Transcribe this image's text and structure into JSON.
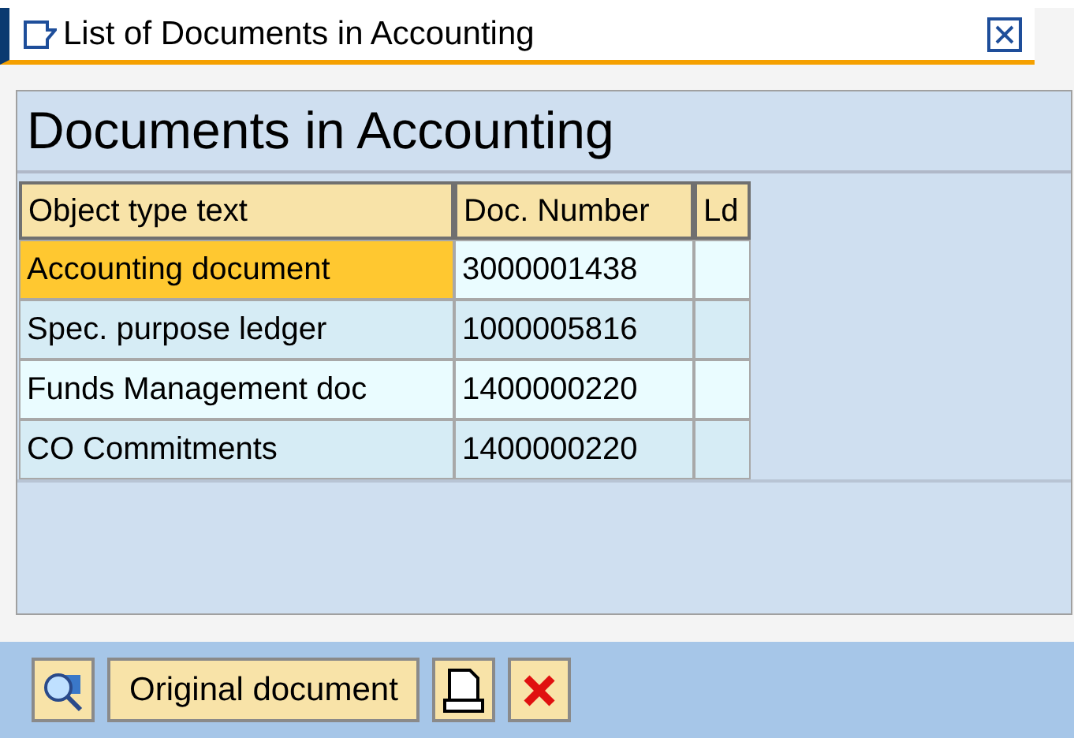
{
  "window": {
    "title": "List of Documents in Accounting"
  },
  "heading": "Documents in Accounting",
  "table": {
    "columns": [
      "Object type text",
      "Doc. Number",
      "Ld"
    ],
    "rows": [
      {
        "cells": [
          "Accounting document",
          "3000001438",
          ""
        ],
        "selected": true
      },
      {
        "cells": [
          "Spec. purpose ledger",
          "1000005816",
          ""
        ],
        "selected": false
      },
      {
        "cells": [
          "Funds Management doc",
          "1400000220",
          ""
        ],
        "selected": false
      },
      {
        "cells": [
          "CO Commitments",
          "1400000220",
          ""
        ],
        "selected": false
      }
    ]
  },
  "toolbar": {
    "buttons": [
      {
        "kind": "icon-find"
      },
      {
        "kind": "text",
        "label": "Original document"
      },
      {
        "kind": "icon-print"
      },
      {
        "kind": "icon-cancel"
      }
    ]
  }
}
